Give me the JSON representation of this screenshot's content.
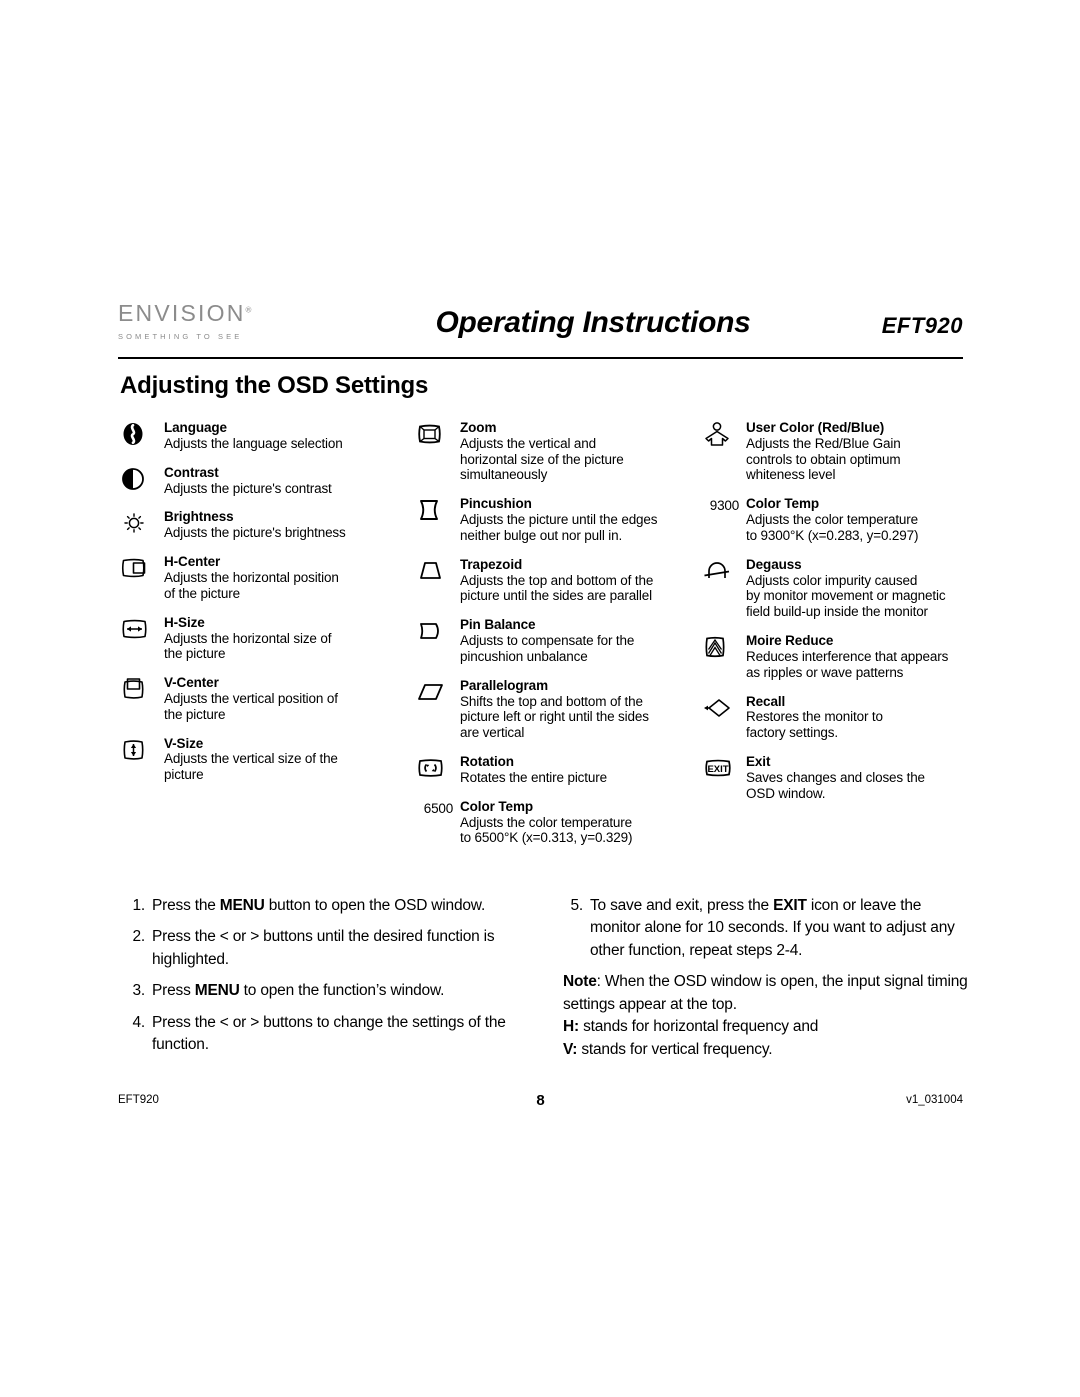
{
  "header": {
    "logo_word": "ENVISION",
    "logo_tm": "®",
    "logo_tagline": "SOMETHING TO SEE",
    "doc_title": "Operating Instructions",
    "model": "EFT920"
  },
  "section_title": "Adjusting the OSD Settings",
  "osd": {
    "column1": [
      {
        "icon": "language-icon",
        "title": "Language",
        "desc": "Adjusts the language selection"
      },
      {
        "icon": "contrast-icon",
        "title": "Contrast",
        "desc": "Adjusts the picture's contrast"
      },
      {
        "icon": "brightness-icon",
        "title": "Brightness",
        "desc": "Adjusts the picture's brightness"
      },
      {
        "icon": "h-center-icon",
        "title": "H-Center",
        "desc": "Adjusts the horizontal position\nof the picture"
      },
      {
        "icon": "h-size-icon",
        "title": "H-Size",
        "desc": "Adjusts the horizontal size of\nthe picture"
      },
      {
        "icon": "v-center-icon",
        "title": "V-Center",
        "desc": "Adjusts the vertical position of\nthe picture"
      },
      {
        "icon": "v-size-icon",
        "title": "V-Size",
        "desc": "Adjusts the vertical size of the\npicture"
      }
    ],
    "column2": [
      {
        "icon": "zoom-icon",
        "title": "Zoom",
        "desc": "Adjusts the vertical and\nhorizontal size of the picture\nsimultaneously"
      },
      {
        "icon": "pincushion-icon",
        "title": "Pincushion",
        "desc": "Adjusts the picture until the edges\nneither bulge out nor pull in."
      },
      {
        "icon": "trapezoid-icon",
        "title": "Trapezoid",
        "desc": "Adjusts the top and bottom of the\npicture until the sides are parallel"
      },
      {
        "icon": "pin-balance-icon",
        "title": "Pin Balance",
        "desc": "Adjusts to compensate for the\npincushion unbalance"
      },
      {
        "icon": "parallelogram-icon",
        "title": "Parallelogram",
        "desc": "Shifts the top and bottom of the\npicture left or right until the sides\n are vertical"
      },
      {
        "icon": "rotation-icon",
        "title": "Rotation",
        "desc": "Rotates the entire picture"
      },
      {
        "number": "6500",
        "icon": "color-temp-6500-label",
        "title": "Color Temp",
        "desc": "Adjusts the color temperature\nto 6500°K (x=0.313, y=0.329)"
      }
    ],
    "column3": [
      {
        "icon": "user-color-icon",
        "title": "User Color (Red/Blue)",
        "desc": "Adjusts the Red/Blue Gain\ncontrols to obtain optimum\nwhiteness level"
      },
      {
        "number": "9300",
        "icon": "color-temp-9300-label",
        "title": "Color Temp",
        "desc": "Adjusts the color temperature\nto 9300°K (x=0.283, y=0.297)"
      },
      {
        "icon": "degauss-icon",
        "title": "Degauss",
        "desc": "Adjusts color impurity caused\nby monitor movement or magnetic\nfield build-up inside the monitor"
      },
      {
        "icon": "moire-reduce-icon",
        "title": "Moire Reduce",
        "desc": "Reduces interference that appears\nas ripples or wave patterns"
      },
      {
        "icon": "recall-icon",
        "title": "Recall",
        "desc": "Restores the monitor to\nfactory settings."
      },
      {
        "icon": "exit-icon",
        "title": "Exit",
        "desc": "Saves changes and closes the\nOSD window."
      }
    ]
  },
  "steps": {
    "left": [
      {
        "num": "1.",
        "pre": "Press the ",
        "bold": "MENU",
        "post": " button to open the OSD window."
      },
      {
        "num": "2.",
        "pre": "Press the < or > buttons until the desired function is highlighted.",
        "bold": "",
        "post": ""
      },
      {
        "num": "3.",
        "pre": "Press ",
        "bold": "MENU",
        "post": " to open the function’s window."
      },
      {
        "num": "4.",
        "pre": "Press the < or > buttons to change the settings of the function.",
        "bold": "",
        "post": ""
      }
    ],
    "right": [
      {
        "num": "5.",
        "pre": "To save and exit, press the ",
        "bold": "EXIT",
        "post": " icon or leave the monitor alone for 10 seconds. If you want to adjust any other function, repeat steps 2-4."
      }
    ],
    "note": {
      "label": "Note",
      "text": ": When the OSD window is open, the input signal timing settings appear at the top.",
      "h_label": "H:",
      "h_text": " stands for horizontal frequency and",
      "v_label": "V:",
      "v_text": " stands for vertical frequency."
    }
  },
  "footer": {
    "left": "EFT920",
    "page": "8",
    "right": "v1_031004"
  },
  "colors": {
    "ink": "#000000",
    "logo_gray": "#8c8c8c",
    "page_bg": "#ffffff"
  }
}
